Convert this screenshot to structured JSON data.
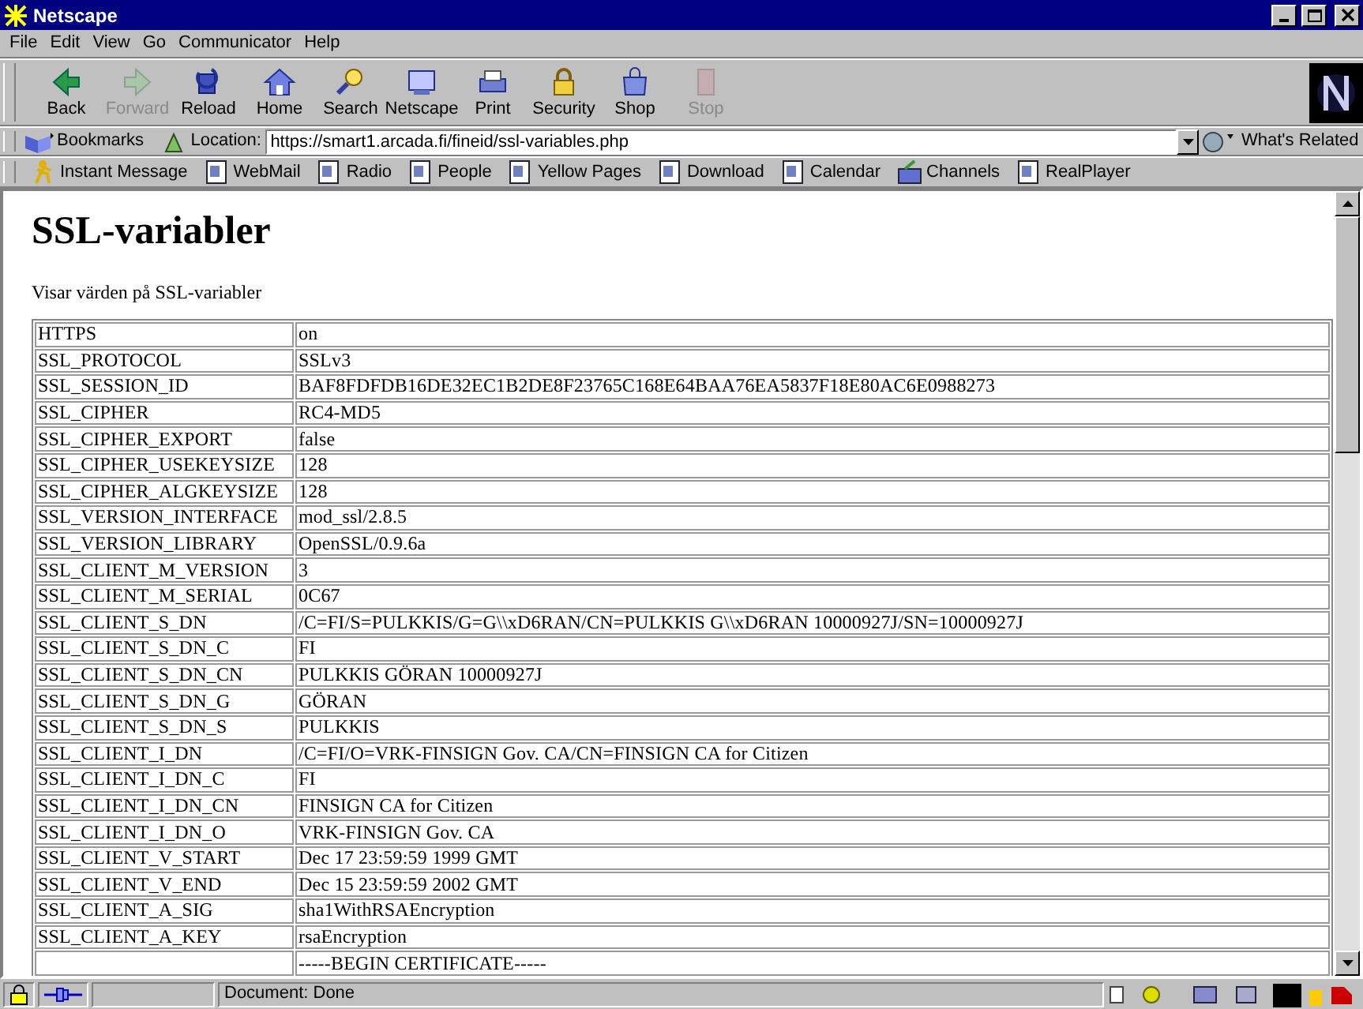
{
  "window": {
    "title": "Netscape"
  },
  "menu": [
    "File",
    "Edit",
    "View",
    "Go",
    "Communicator",
    "Help"
  ],
  "toolbar": [
    {
      "label": "Back",
      "disabled": false
    },
    {
      "label": "Forward",
      "disabled": true
    },
    {
      "label": "Reload",
      "disabled": false
    },
    {
      "label": "Home",
      "disabled": false
    },
    {
      "label": "Search",
      "disabled": false
    },
    {
      "label": "Netscape",
      "disabled": false
    },
    {
      "label": "Print",
      "disabled": false
    },
    {
      "label": "Security",
      "disabled": false
    },
    {
      "label": "Shop",
      "disabled": false
    },
    {
      "label": "Stop",
      "disabled": true
    }
  ],
  "location": {
    "bookmarks": "Bookmarks",
    "label": "Location:",
    "url": "https://smart1.arcada.fi/fineid/ssl-variables.php",
    "whats_related": "What's Related"
  },
  "personal_toolbar": [
    {
      "label": "Instant Message",
      "kind": "messenger"
    },
    {
      "label": "WebMail",
      "kind": "bookmark"
    },
    {
      "label": "Radio",
      "kind": "bookmark"
    },
    {
      "label": "People",
      "kind": "bookmark"
    },
    {
      "label": "Yellow Pages",
      "kind": "bookmark"
    },
    {
      "label": "Download",
      "kind": "bookmark"
    },
    {
      "label": "Calendar",
      "kind": "bookmark"
    },
    {
      "label": "Channels",
      "kind": "channel"
    },
    {
      "label": "RealPlayer",
      "kind": "bookmark"
    }
  ],
  "page": {
    "heading": "SSL-variabler",
    "intro": "Visar värden på SSL-variabler",
    "rows": [
      {
        "name": "HTTPS",
        "value": "on"
      },
      {
        "name": "SSL_PROTOCOL",
        "value": "SSLv3"
      },
      {
        "name": "SSL_SESSION_ID",
        "value": "BAF8FDFDB16DE32EC1B2DE8F23765C168E64BAA76EA5837F18E80AC6E0988273"
      },
      {
        "name": "SSL_CIPHER",
        "value": "RC4-MD5"
      },
      {
        "name": "SSL_CIPHER_EXPORT",
        "value": "false"
      },
      {
        "name": "SSL_CIPHER_USEKEYSIZE",
        "value": "128"
      },
      {
        "name": "SSL_CIPHER_ALGKEYSIZE",
        "value": "128"
      },
      {
        "name": "SSL_VERSION_INTERFACE",
        "value": "mod_ssl/2.8.5"
      },
      {
        "name": "SSL_VERSION_LIBRARY",
        "value": "OpenSSL/0.9.6a"
      },
      {
        "name": "SSL_CLIENT_M_VERSION",
        "value": "3"
      },
      {
        "name": "SSL_CLIENT_M_SERIAL",
        "value": "0C67"
      },
      {
        "name": "SSL_CLIENT_S_DN",
        "value": "/C=FI/S=PULKKIS/G=G\\\\xD6RAN/CN=PULKKIS G\\\\xD6RAN 10000927J/SN=10000927J"
      },
      {
        "name": "SSL_CLIENT_S_DN_C",
        "value": "FI"
      },
      {
        "name": "SSL_CLIENT_S_DN_CN",
        "value": "PULKKIS GÖRAN 10000927J"
      },
      {
        "name": "SSL_CLIENT_S_DN_G",
        "value": "GÖRAN"
      },
      {
        "name": "SSL_CLIENT_S_DN_S",
        "value": "PULKKIS"
      },
      {
        "name": "SSL_CLIENT_I_DN",
        "value": "/C=FI/O=VRK-FINSIGN Gov. CA/CN=FINSIGN CA for Citizen"
      },
      {
        "name": "SSL_CLIENT_I_DN_C",
        "value": "FI"
      },
      {
        "name": "SSL_CLIENT_I_DN_CN",
        "value": "FINSIGN CA for Citizen"
      },
      {
        "name": "SSL_CLIENT_I_DN_O",
        "value": "VRK-FINSIGN Gov. CA"
      },
      {
        "name": "SSL_CLIENT_V_START",
        "value": "Dec 17 23:59:59 1999 GMT"
      },
      {
        "name": "SSL_CLIENT_V_END",
        "value": "Dec 15 23:59:59 2002 GMT"
      },
      {
        "name": "SSL_CLIENT_A_SIG",
        "value": "sha1WithRSAEncryption"
      },
      {
        "name": "SSL_CLIENT_A_KEY",
        "value": "rsaEncryption"
      },
      {
        "name": "",
        "value": "-----BEGIN CERTIFICATE-----"
      }
    ]
  },
  "status_bar": {
    "text": "Document: Done"
  }
}
